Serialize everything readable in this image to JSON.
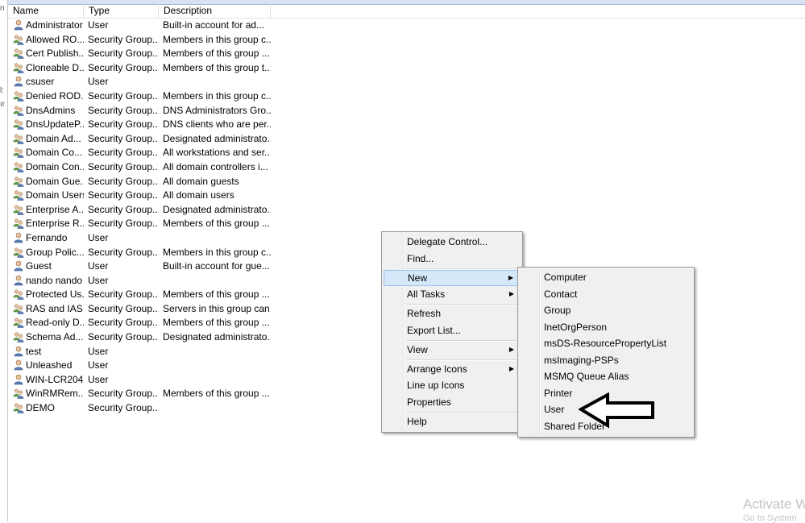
{
  "columns": {
    "name": "Name",
    "type": "Type",
    "description": "Description"
  },
  "rows": [
    {
      "icon": "user-icon",
      "name": "Administrator",
      "type": "User",
      "description": "Built-in account for ad..."
    },
    {
      "icon": "group-icon",
      "name": "Allowed RO...",
      "type": "Security Group...",
      "description": "Members in this group c..."
    },
    {
      "icon": "group-icon",
      "name": "Cert Publish...",
      "type": "Security Group...",
      "description": "Members of this group ..."
    },
    {
      "icon": "group-icon",
      "name": "Cloneable D...",
      "type": "Security Group...",
      "description": "Members of this group t..."
    },
    {
      "icon": "user-icon",
      "name": "csuser",
      "type": "User",
      "description": ""
    },
    {
      "icon": "group-icon",
      "name": "Denied ROD...",
      "type": "Security Group...",
      "description": "Members in this group c..."
    },
    {
      "icon": "group-icon",
      "name": "DnsAdmins",
      "type": "Security Group...",
      "description": "DNS Administrators Gro..."
    },
    {
      "icon": "group-icon",
      "name": "DnsUpdateP...",
      "type": "Security Group...",
      "description": "DNS clients who are per..."
    },
    {
      "icon": "group-icon",
      "name": "Domain Ad...",
      "type": "Security Group...",
      "description": "Designated administrato..."
    },
    {
      "icon": "group-icon",
      "name": "Domain Co...",
      "type": "Security Group...",
      "description": "All workstations and ser..."
    },
    {
      "icon": "group-icon",
      "name": "Domain Con...",
      "type": "Security Group...",
      "description": "All domain controllers i..."
    },
    {
      "icon": "group-icon",
      "name": "Domain Gue...",
      "type": "Security Group...",
      "description": "All domain guests"
    },
    {
      "icon": "group-icon",
      "name": "Domain Users",
      "type": "Security Group...",
      "description": "All domain users"
    },
    {
      "icon": "group-icon",
      "name": "Enterprise A...",
      "type": "Security Group...",
      "description": "Designated administrato..."
    },
    {
      "icon": "group-icon",
      "name": "Enterprise R...",
      "type": "Security Group...",
      "description": "Members of this group ..."
    },
    {
      "icon": "user-icon",
      "name": "Fernando",
      "type": "User",
      "description": ""
    },
    {
      "icon": "group-icon",
      "name": "Group Polic...",
      "type": "Security Group...",
      "description": "Members in this group c..."
    },
    {
      "icon": "user-icon",
      "name": "Guest",
      "type": "User",
      "description": "Built-in account for gue..."
    },
    {
      "icon": "user-icon",
      "name": "nando nando",
      "type": "User",
      "description": ""
    },
    {
      "icon": "group-icon",
      "name": "Protected Us...",
      "type": "Security Group...",
      "description": "Members of this group ..."
    },
    {
      "icon": "group-icon",
      "name": "RAS and IAS ...",
      "type": "Security Group...",
      "description": "Servers in this group can..."
    },
    {
      "icon": "group-icon",
      "name": "Read-only D...",
      "type": "Security Group...",
      "description": "Members of this group ..."
    },
    {
      "icon": "group-icon",
      "name": "Schema Ad...",
      "type": "Security Group...",
      "description": "Designated administrato..."
    },
    {
      "icon": "user-icon",
      "name": "test",
      "type": "User",
      "description": ""
    },
    {
      "icon": "user-icon",
      "name": "Unleashed",
      "type": "User",
      "description": ""
    },
    {
      "icon": "user-icon",
      "name": "WIN-LCR204...",
      "type": "User",
      "description": ""
    },
    {
      "icon": "group-icon",
      "name": "WinRMRem...",
      "type": "Security Group...",
      "description": "Members of this group ..."
    },
    {
      "icon": "group-icon",
      "name": "DEMO",
      "type": "Security Group...",
      "description": ""
    }
  ],
  "context_menu": {
    "delegate": "Delegate Control...",
    "find": "Find...",
    "new": "New",
    "all_tasks": "All Tasks",
    "refresh": "Refresh",
    "export": "Export List...",
    "view": "View",
    "arrange": "Arrange Icons",
    "lineup": "Line up Icons",
    "properties": "Properties",
    "help": "Help"
  },
  "new_submenu": [
    "Computer",
    "Contact",
    "Group",
    "InetOrgPerson",
    "msDS-ResourcePropertyList",
    "msImaging-PSPs",
    "MSMQ Queue Alias",
    "Printer",
    "User",
    "Shared Folder"
  ],
  "watermark": {
    "line1": "Activate W",
    "line2": "Go to System"
  },
  "left_fragments": [
    "n",
    "l:",
    "ır"
  ],
  "colors": {
    "highlight": "#d5e8fa",
    "menu_bg": "#f0f0f0"
  }
}
